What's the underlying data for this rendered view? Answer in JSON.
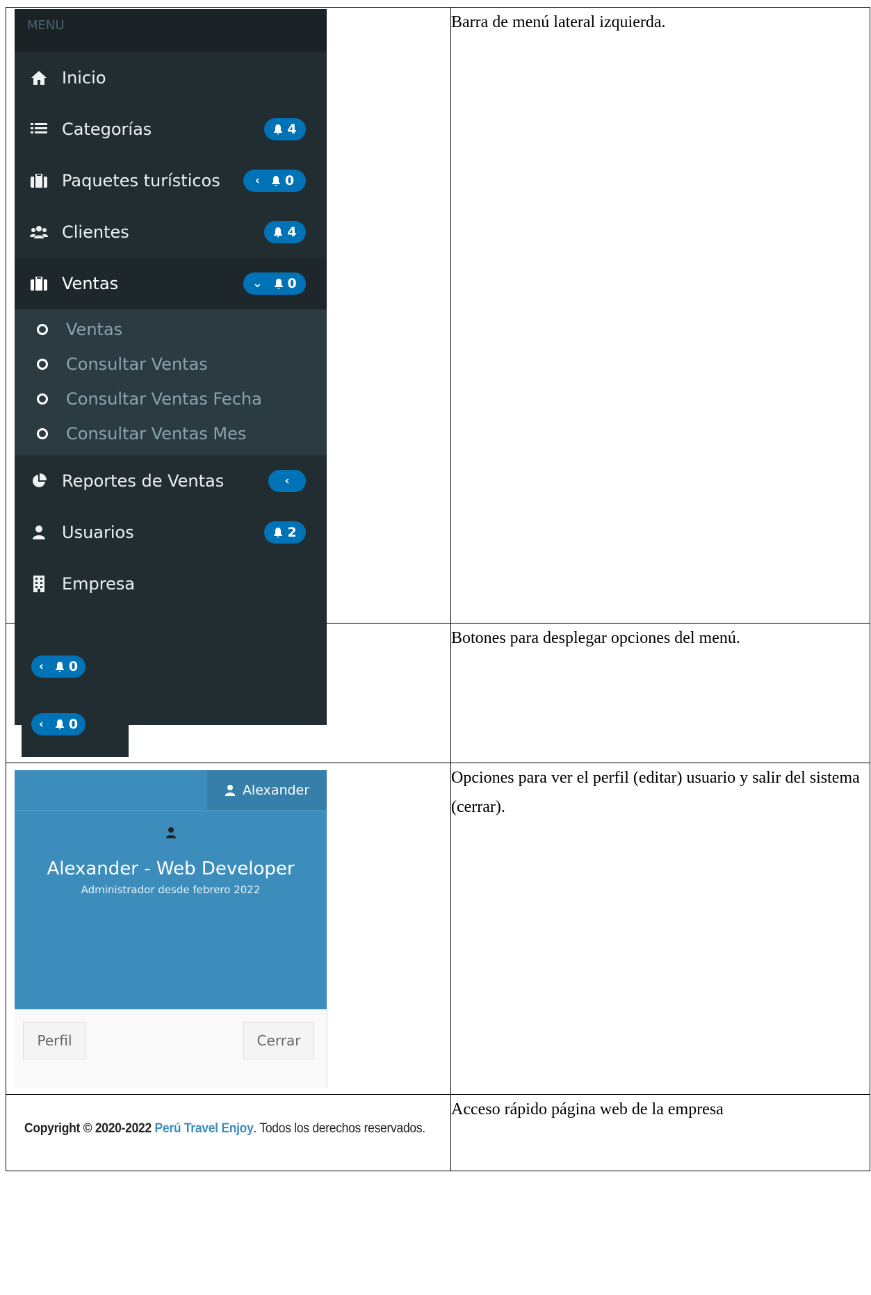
{
  "sidebar": {
    "header": "MENU",
    "items": [
      {
        "label": "Inicio",
        "icon": "home-icon"
      },
      {
        "label": "Categorías",
        "icon": "list-icon",
        "badge": "4"
      },
      {
        "label": "Paquetes turísticos",
        "icon": "suitcase-icon",
        "badge": "0",
        "chevron": "‹"
      },
      {
        "label": "Clientes",
        "icon": "users-icon",
        "badge": "4"
      },
      {
        "label": "Ventas",
        "icon": "suitcase-icon",
        "badge": "0",
        "chevron": "⌄"
      },
      {
        "label": "Reportes de Ventas",
        "icon": "pie-chart-icon",
        "chevron": "‹"
      },
      {
        "label": "Usuarios",
        "icon": "user-icon",
        "badge": "2"
      },
      {
        "label": "Empresa",
        "icon": "building-icon"
      }
    ],
    "submenu": [
      "Ventas",
      "Consultar Ventas",
      "Consultar Ventas Fecha",
      "Consultar Ventas Mes"
    ]
  },
  "buttons_demo": {
    "chevron": "‹",
    "badges": [
      "0",
      "0"
    ]
  },
  "profile": {
    "top_user": "Alexander",
    "name": "Alexander - Web Developer",
    "since": "Administrador desde febrero 2022",
    "profile_button": "Perfil",
    "logout_button": "Cerrar"
  },
  "footer": {
    "prefix": "Copyright © 2020-2022",
    "brand": "Perú Travel Enjoy",
    "suffix": ". Todos los derechos reservados."
  },
  "descriptions": {
    "row1": "Barra de menú lateral izquierda.",
    "row2": "Botones para desplegar opciones del menú.",
    "row3": "Opciones para ver el perfil (editar) usuario y salir del sistema (cerrar).",
    "row4": "Acceso rápido página web de la empresa"
  },
  "colors": {
    "sidebar_bg": "#222d32",
    "accent_blue": "#0073b7",
    "profile_blue": "#3c8dbc"
  }
}
